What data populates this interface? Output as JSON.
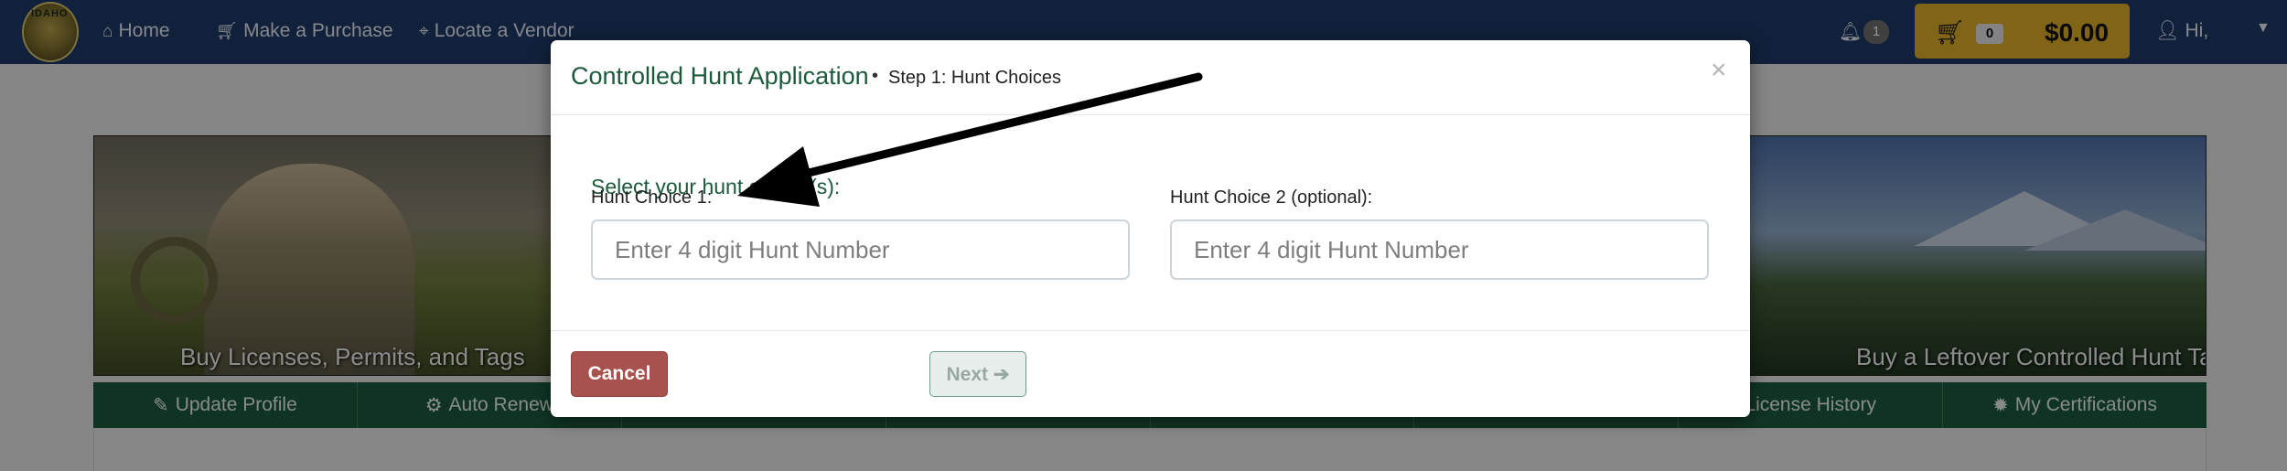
{
  "navbar": {
    "home_label": "Home",
    "purchase_label": "Make a Purchase",
    "vendor_label": "Locate a Vendor",
    "notification_count": "1",
    "cart_count": "0",
    "cart_total": "$0.00",
    "user_greeting": "Hi,",
    "logo_text": "IDAHO"
  },
  "banner": {
    "left_caption": "Buy Licenses, Permits, and Tags",
    "right_caption": "Buy a Leftover Controlled Hunt Tag"
  },
  "subnav": {
    "items": [
      {
        "label": "Update Profile",
        "icon": "edit-icon",
        "glyph": "✎"
      },
      {
        "label": "Auto Renew",
        "icon": "gear-icon",
        "glyph": "⚙"
      },
      {
        "label": "",
        "icon": "",
        "glyph": ""
      },
      {
        "label": "",
        "icon": "",
        "glyph": ""
      },
      {
        "label": "",
        "icon": "",
        "glyph": ""
      },
      {
        "label": "",
        "icon": "",
        "glyph": ""
      },
      {
        "label": "License History",
        "icon": "",
        "glyph": ""
      },
      {
        "label": "My Certifications",
        "icon": "certificate-icon",
        "glyph": "✹"
      }
    ]
  },
  "modal": {
    "title": "Controlled Hunt Application",
    "separator": "•",
    "step": "Step 1: Hunt Choices",
    "close_glyph": "×",
    "select_prompt": "Select your hunt choice(s):",
    "hunt_choice_1": {
      "label": "Hunt Choice 1:",
      "placeholder": "Enter 4 digit Hunt Number",
      "value": ""
    },
    "hunt_choice_2": {
      "label": "Hunt Choice 2 (optional):",
      "placeholder": "Enter 4 digit Hunt Number",
      "value": ""
    },
    "cancel_label": "Cancel",
    "next_label": "Next ➔"
  },
  "colors": {
    "navbar": "#1e3a66",
    "cart": "#dcae2c",
    "subnav": "#1c5b3f",
    "modal_title": "#1b5a3a",
    "cancel_button": "#a8524e"
  }
}
